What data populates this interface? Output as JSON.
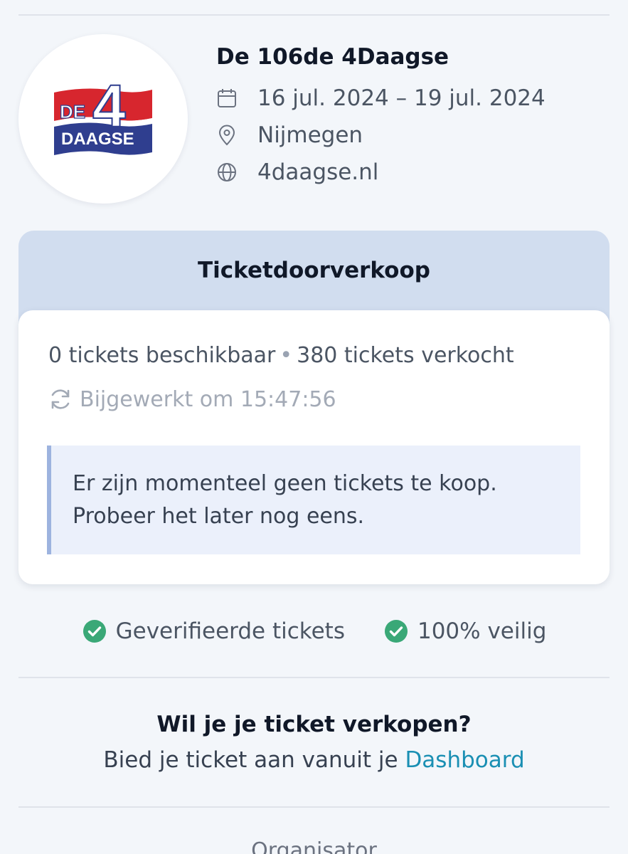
{
  "event": {
    "logo": {
      "text_de": "DE",
      "text_four": "4",
      "text_daagse": "DAAGSE"
    },
    "title": "De 106de 4Daagse",
    "date_range": "16 jul. 2024 – 19 jul. 2024",
    "location": "Nijmegen",
    "website": "4daagse.nl"
  },
  "ticket_panel": {
    "title": "Ticketdoorverkoop",
    "available": "0 tickets beschikbaar",
    "separator": "•",
    "sold": "380 tickets verkocht",
    "updated": "Bijgewerkt om 15:47:56",
    "notice_line1": "Er zijn momenteel geen tickets te koop.",
    "notice_line2": "Probeer het later nog eens."
  },
  "trust": {
    "verified": "Geverifieerde tickets",
    "secure": "100% veilig"
  },
  "sell": {
    "heading": "Wil je je ticket verkopen?",
    "text": "Bied je ticket aan vanuit je ",
    "link": "Dashboard"
  },
  "organizer": {
    "label": "Organisator"
  },
  "icons": {
    "calendar": "calendar-icon",
    "location": "map-pin-icon",
    "website": "globe-icon",
    "refresh": "refresh-icon",
    "check": "check-circle-icon"
  },
  "colors": {
    "background": "#f3f6fa",
    "panel_header": "#d1ddef",
    "notice_bg": "#ebf0fb",
    "notice_border": "#9db3df",
    "check_green": "#3aa877",
    "link": "#1a8fb3",
    "logo_red": "#d7262e",
    "logo_blue": "#2f3e8f"
  }
}
